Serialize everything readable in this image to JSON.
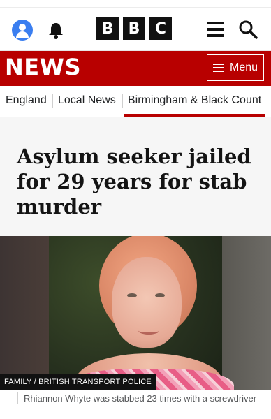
{
  "header": {
    "account_icon": "account-icon",
    "notifications_icon": "bell-icon",
    "logo_letters": [
      "B",
      "B",
      "C"
    ],
    "menu_icon": "hamburger-icon",
    "search_icon": "search-icon"
  },
  "news_bar": {
    "title": "NEWS",
    "menu_label": "Menu",
    "color": "#b80000"
  },
  "subnav": {
    "items": [
      "England",
      "Local News",
      "Birmingham & Black Count"
    ],
    "active_index": 2
  },
  "article": {
    "headline": "Asylum seeker jailed for 29 years for stab murder",
    "image_credit": "FAMILY / BRITISH TRANSPORT POLICE",
    "caption": "Rhiannon Whyte was stabbed 23 times with a screwdriver"
  }
}
